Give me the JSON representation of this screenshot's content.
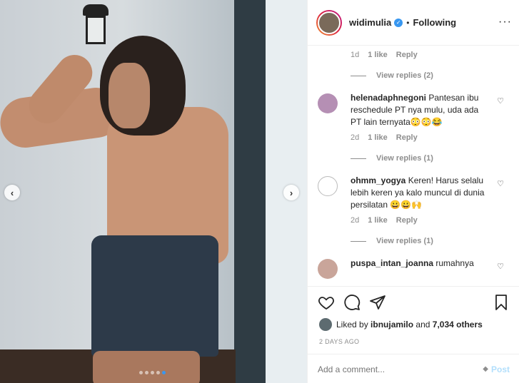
{
  "header": {
    "username": "widimulia",
    "verified_symbol": "✓",
    "separator": "•",
    "follow_status": "Following",
    "more_symbol": "···"
  },
  "photo": {
    "prev_symbol": "‹",
    "next_symbol": "›",
    "slide_count": 5,
    "active_slide": 5
  },
  "comments": {
    "first_meta": {
      "time": "1d",
      "likes": "1 like",
      "reply": "Reply"
    },
    "first_view_replies": "View replies (2)",
    "items": [
      {
        "username": "helenadaphnegoni",
        "text": "Pantesan ibu reschedule PT nya mulu, uda ada PT lain ternyata😳😳😂",
        "time": "2d",
        "likes": "1 like",
        "reply": "Reply",
        "view_replies": "View replies (1)",
        "avatar_color": "#b58fb4"
      },
      {
        "username": "ohmm_yogya",
        "text": "Keren! Harus selalu lebih keren ya kalo muncul di dunia persilatan 😀😀🙌",
        "time": "2d",
        "likes": "1 like",
        "reply": "Reply",
        "view_replies": "View replies (1)",
        "avatar_color": "#ffffff"
      },
      {
        "username": "puspa_intan_joanna",
        "text": "rumahnya",
        "avatar_color": "#c9a59a"
      }
    ],
    "heart_symbol": "♡"
  },
  "actions": {
    "liked_by_prefix": "Liked by",
    "liked_by_user": "ibnujamilo",
    "liked_by_middle": "and",
    "liked_by_count": "7,034 others",
    "date": "2 DAYS AGO"
  },
  "add_comment": {
    "placeholder": "Add a comment...",
    "emoji_symbol": "◆",
    "post_label": "Post"
  },
  "colors": {
    "accent": "#3897f0",
    "post_disabled": "#b2dffc",
    "muted": "#8e8e8e"
  }
}
